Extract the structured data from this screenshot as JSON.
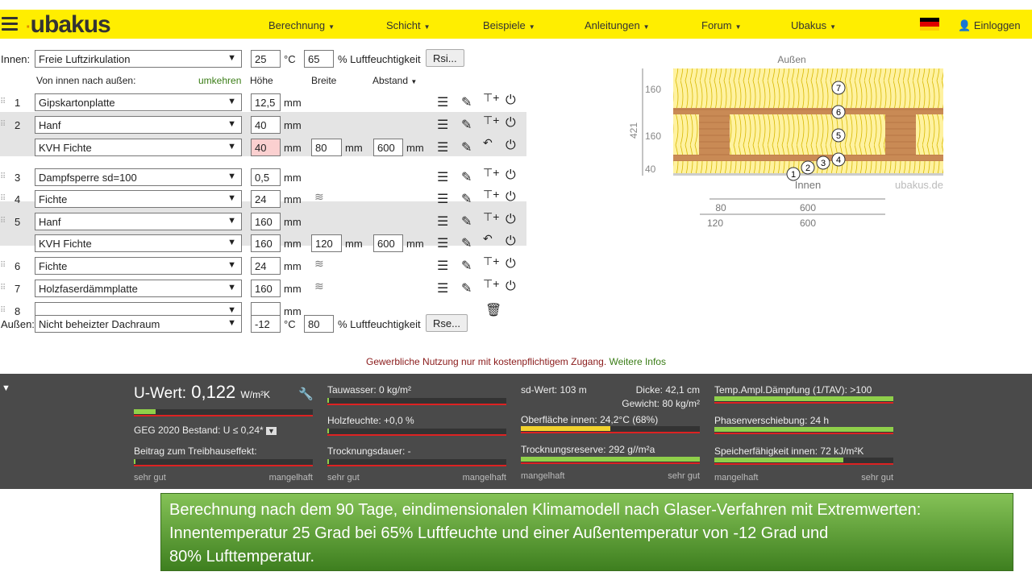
{
  "nav": {
    "logo": "ubakus",
    "items": [
      "Berechnung",
      "Schicht",
      "Beispiele",
      "Anleitungen",
      "Forum",
      "Ubakus"
    ],
    "login": "Einloggen"
  },
  "inside": {
    "label": "Innen:",
    "condition": "Freie Luftzirkulation",
    "temp": "25",
    "temp_unit": "°C",
    "humidity": "65",
    "humidity_label": "% Luftfeuchtigkeit",
    "rsi_button": "Rsi..."
  },
  "header": {
    "direction": "Von innen nach außen:",
    "reverse": "umkehren",
    "col_height": "Höhe",
    "col_width": "Breite",
    "col_distance": "Abstand"
  },
  "layers": [
    {
      "num": "1",
      "material": "Gipskartonplatte",
      "height": "12,5"
    },
    {
      "num": "2",
      "material": "Hanf",
      "height": "40",
      "sub": {
        "material": "KVH Fichte",
        "height": "40",
        "width": "80",
        "distance": "600"
      }
    },
    {
      "num": "3",
      "material": "Dampfsperre sd=100",
      "height": "0,5"
    },
    {
      "num": "4",
      "material": "Fichte",
      "height": "24"
    },
    {
      "num": "5",
      "material": "Hanf",
      "height": "160",
      "sub": {
        "material": "KVH Fichte",
        "height": "160",
        "width": "120",
        "distance": "600"
      }
    },
    {
      "num": "6",
      "material": "Fichte",
      "height": "24"
    },
    {
      "num": "7",
      "material": "Holzfaserdämmplatte",
      "height": "160"
    },
    {
      "num": "8",
      "material": "",
      "height": ""
    }
  ],
  "unit_mm": "mm",
  "outside": {
    "label": "Außen:",
    "condition": "Nicht beheizter Dachraum",
    "temp": "-12",
    "temp_unit": "°C",
    "humidity": "80",
    "humidity_label": "% Luftfeuchtigkeit",
    "rse_button": "Rse..."
  },
  "drawing": {
    "outside_label": "Außen",
    "inside_label": "Innen",
    "watermark": "ubakus.de",
    "dim_labels": [
      "160",
      "160",
      "40",
      "421"
    ],
    "bottom_dims": [
      "80",
      "600",
      "120",
      "600"
    ],
    "markers": [
      "1",
      "2",
      "3",
      "4",
      "5",
      "6",
      "7"
    ]
  },
  "notice": {
    "text": "Gewerbliche Nutzung nur mit kostenpflichtigem Zugang.",
    "link": "Weitere Infos"
  },
  "results": {
    "uwert_label": "U-Wert:",
    "uwert_value": "0,122",
    "uwert_unit": "W/m²K",
    "geg": "GEG 2020 Bestand: U ≤ 0,24*",
    "treibhaus": "Beitrag zum Treibhauseffekt:",
    "tauwasser": "Tauwasser: 0 kg/m²",
    "holzfeuchte": "Holzfeuchte: +0,0 %",
    "trocknungsdauer": "Trocknungsdauer: -",
    "sdwert": "sd-Wert: 103 m",
    "dicke": "Dicke: 42,1 cm",
    "gewicht": "Gewicht: 80 kg/m²",
    "oberflaeche": "Oberfläche innen: 24,2°C (68%)",
    "trocknungsreserve": "Trocknungsreserve: 292 g//m²a",
    "tav": "Temp.Ampl.Dämpfung (1/TAV): >100",
    "phase": "Phasenverschiebung: 24 h",
    "speicher": "Speicherfähigkeit innen: 72 kJ/m²K",
    "sehr_gut": "sehr gut",
    "mangelhaft": "mangelhaft",
    "uwert_level": 0.12,
    "oberflaeche_level": 0.5,
    "trocknungsreserve_level": 1.0,
    "tav_level": 1.0,
    "phase_level": 1.0,
    "speicher_level": 0.72
  },
  "callout": {
    "line1": "Berechnung nach dem  90 Tage, eindimensionalen Klimamodell nach Glaser-Verfahren mit Extremwerten:",
    "line2": "Innentemperatur 25 Grad bei 65% Luftfeuchte und einer Außentemperatur von -12 Grad  und",
    "line3": "80% Lufttemperatur."
  }
}
